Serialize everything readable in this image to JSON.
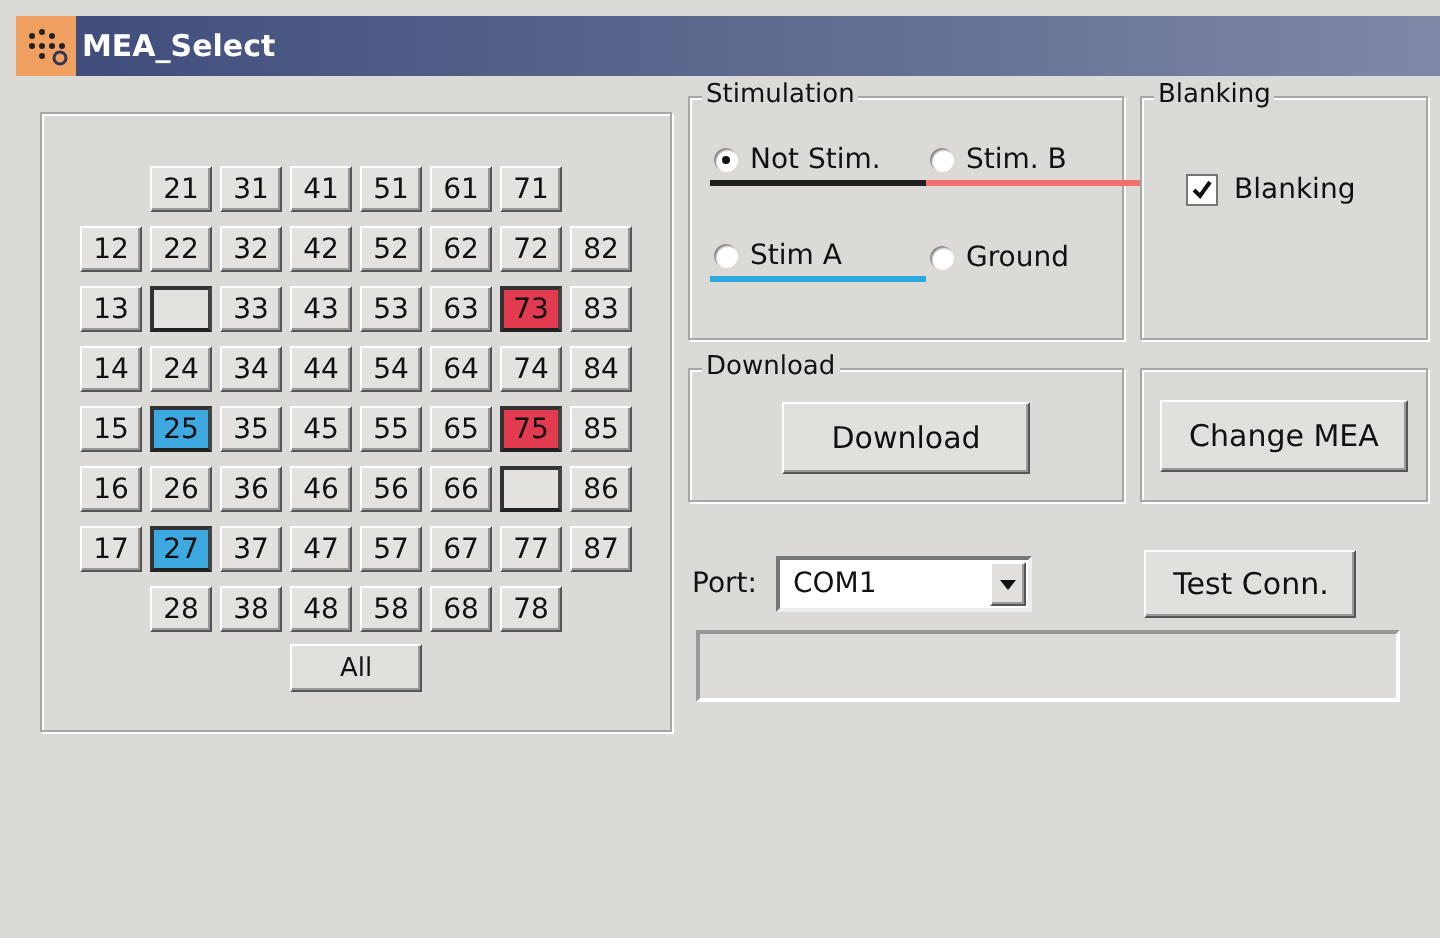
{
  "window": {
    "title": "MEA_Select"
  },
  "electrodes": {
    "rows": [
      [
        {
          "label": "21",
          "kind": "normal"
        },
        {
          "label": "31",
          "kind": "normal"
        },
        {
          "label": "41",
          "kind": "normal"
        },
        {
          "label": "51",
          "kind": "normal"
        },
        {
          "label": "61",
          "kind": "normal"
        },
        {
          "label": "71",
          "kind": "normal"
        }
      ],
      [
        {
          "label": "12",
          "kind": "normal"
        },
        {
          "label": "22",
          "kind": "normal"
        },
        {
          "label": "32",
          "kind": "normal"
        },
        {
          "label": "42",
          "kind": "normal"
        },
        {
          "label": "52",
          "kind": "normal"
        },
        {
          "label": "62",
          "kind": "normal"
        },
        {
          "label": "72",
          "kind": "normal"
        },
        {
          "label": "82",
          "kind": "normal"
        }
      ],
      [
        {
          "label": "13",
          "kind": "normal"
        },
        {
          "kind": "ground"
        },
        {
          "label": "33",
          "kind": "normal"
        },
        {
          "label": "43",
          "kind": "normal"
        },
        {
          "label": "53",
          "kind": "normal"
        },
        {
          "label": "63",
          "kind": "normal"
        },
        {
          "label": "73",
          "kind": "stim_b"
        },
        {
          "label": "83",
          "kind": "normal"
        }
      ],
      [
        {
          "label": "14",
          "kind": "normal"
        },
        {
          "label": "24",
          "kind": "normal"
        },
        {
          "label": "34",
          "kind": "normal"
        },
        {
          "label": "44",
          "kind": "normal"
        },
        {
          "label": "54",
          "kind": "normal"
        },
        {
          "label": "64",
          "kind": "normal"
        },
        {
          "label": "74",
          "kind": "normal"
        },
        {
          "label": "84",
          "kind": "normal"
        }
      ],
      [
        {
          "label": "15",
          "kind": "normal"
        },
        {
          "label": "25",
          "kind": "stim_a"
        },
        {
          "label": "35",
          "kind": "normal"
        },
        {
          "label": "45",
          "kind": "normal"
        },
        {
          "label": "55",
          "kind": "normal"
        },
        {
          "label": "65",
          "kind": "normal"
        },
        {
          "label": "75",
          "kind": "stim_b"
        },
        {
          "label": "85",
          "kind": "normal"
        }
      ],
      [
        {
          "label": "16",
          "kind": "normal"
        },
        {
          "label": "26",
          "kind": "normal"
        },
        {
          "label": "36",
          "kind": "normal"
        },
        {
          "label": "46",
          "kind": "normal"
        },
        {
          "label": "56",
          "kind": "normal"
        },
        {
          "label": "66",
          "kind": "normal"
        },
        {
          "kind": "ground"
        },
        {
          "label": "86",
          "kind": "normal"
        }
      ],
      [
        {
          "label": "17",
          "kind": "normal"
        },
        {
          "label": "27",
          "kind": "stim_a"
        },
        {
          "label": "37",
          "kind": "normal"
        },
        {
          "label": "47",
          "kind": "normal"
        },
        {
          "label": "57",
          "kind": "normal"
        },
        {
          "label": "67",
          "kind": "normal"
        },
        {
          "label": "77",
          "kind": "normal"
        },
        {
          "label": "87",
          "kind": "normal"
        }
      ],
      [
        {
          "label": "28",
          "kind": "normal"
        },
        {
          "label": "38",
          "kind": "normal"
        },
        {
          "label": "48",
          "kind": "normal"
        },
        {
          "label": "58",
          "kind": "normal"
        },
        {
          "label": "68",
          "kind": "normal"
        },
        {
          "label": "78",
          "kind": "normal"
        }
      ]
    ],
    "all_button": "All"
  },
  "stimulation": {
    "title": "Stimulation",
    "options": [
      {
        "label": "Not Stim.",
        "selected": true,
        "color": "#202020"
      },
      {
        "label": "Stim. B",
        "selected": false,
        "color": "#f07070"
      },
      {
        "label": "Stim A",
        "selected": false,
        "color": "#30a8e0"
      },
      {
        "label": "Ground",
        "selected": false
      }
    ]
  },
  "blanking": {
    "title": "Blanking",
    "checkbox": {
      "label": "Blanking",
      "checked": true
    }
  },
  "download": {
    "title": "Download",
    "button": "Download"
  },
  "change_mea_button": "Change MEA",
  "port": {
    "label": "Port:",
    "value": "COM1"
  },
  "test_button": "Test Conn."
}
